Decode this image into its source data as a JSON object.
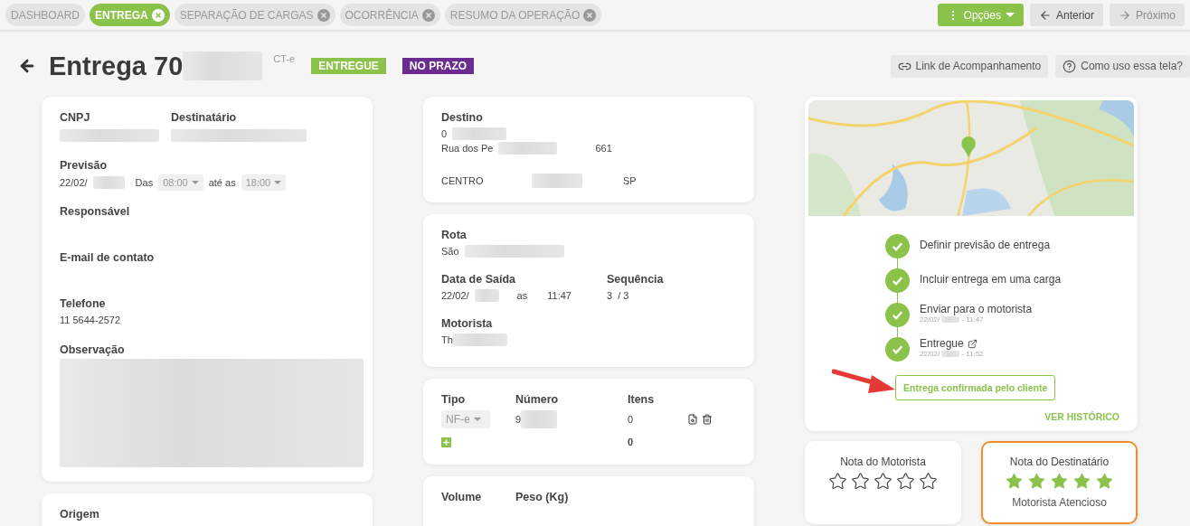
{
  "tabs": [
    {
      "label": "DASHBOARD",
      "closable": false,
      "selected": false
    },
    {
      "label": "ENTREGA",
      "closable": true,
      "selected": true
    },
    {
      "label": "SEPARAÇÃO DE CARGAS",
      "closable": true,
      "selected": false
    },
    {
      "label": "OCORRÊNCIA",
      "closable": true,
      "selected": false
    },
    {
      "label": "RESUMO DA OPERAÇÃO",
      "closable": true,
      "selected": false
    }
  ],
  "toolbar": {
    "options": "Opções",
    "previous": {
      "label": "Anterior",
      "disabled": false
    },
    "next": {
      "label": "Próximo",
      "disabled": true
    }
  },
  "header": {
    "title": "Entrega 70",
    "title_redacted": true,
    "doc_type": "CT-e",
    "badges": [
      {
        "label": "ENTREGUE",
        "color": "#8bc34a"
      },
      {
        "label": "NO PRAZO",
        "color": "#6a2c91"
      }
    ],
    "links": [
      {
        "kind": "link",
        "label": "Link de Acompanhamento"
      },
      {
        "kind": "help",
        "label": "Como uso essa tela?"
      }
    ]
  },
  "recipient": {
    "cnpj": {
      "label": "CNPJ",
      "redacted": true
    },
    "destinatario": {
      "label": "Destinatário",
      "redacted": true
    },
    "previsao": {
      "label": "Previsão",
      "date": "22/02/",
      "redacted": true,
      "from_label": "Das",
      "from": "08:00",
      "to_label": "até as",
      "to": "18:00"
    },
    "fields": [
      {
        "label": "Responsável"
      },
      {
        "label": "E-mail de contato"
      },
      {
        "label": "Telefone",
        "value": "11 5644-2572"
      }
    ],
    "observacao": {
      "label": "Observação",
      "redacted": true
    }
  },
  "origin": {
    "label": "Origem"
  },
  "destination": {
    "label": "Destino",
    "number": "0",
    "street": "Rua dos Pe",
    "street_number": "661",
    "district": "CENTRO",
    "state": "SP",
    "redacted": true
  },
  "route": {
    "label": "Rota",
    "value": "São",
    "redacted": true,
    "departure_label": "Data de Saída",
    "departure_date": "22/02/",
    "at": "as",
    "departure_time": "11:47",
    "sequence_label": "Sequência",
    "sequence": "3",
    "sequence_total": "/ 3",
    "driver_label": "Motorista",
    "driver": "Th"
  },
  "documents": {
    "columns": [
      "Tipo",
      "Número",
      "Itens"
    ],
    "rows": [
      {
        "type": "NF-e",
        "number": "9",
        "items": "0"
      }
    ],
    "total_items": "0"
  },
  "cargo": {
    "columns": [
      "Volume",
      "Peso (Kg)"
    ]
  },
  "tracking": {
    "steps": [
      {
        "label": "Definir previsão de entrega",
        "done": true,
        "external": false
      },
      {
        "label": "Incluir entrega em uma carga",
        "done": true,
        "external": false
      },
      {
        "label": "Enviar para o motorista",
        "done": true,
        "external": false,
        "date": "22/02/",
        "time": "- 11:47"
      },
      {
        "label": "Entregue",
        "done": true,
        "external": true,
        "date": "22/02/",
        "time": "- 11:52"
      }
    ],
    "confirm_button": "Entrega confirmada pelo cliente",
    "history_link": "VER HISTÓRICO",
    "annotation_arrow": true
  },
  "ratings": [
    {
      "title": "Nota do Motorista",
      "stars": 0,
      "highlighted": false
    },
    {
      "title": "Nota do Destinatário",
      "stars": 5,
      "comment": "Motorista Atencioso",
      "highlighted": true
    }
  ]
}
